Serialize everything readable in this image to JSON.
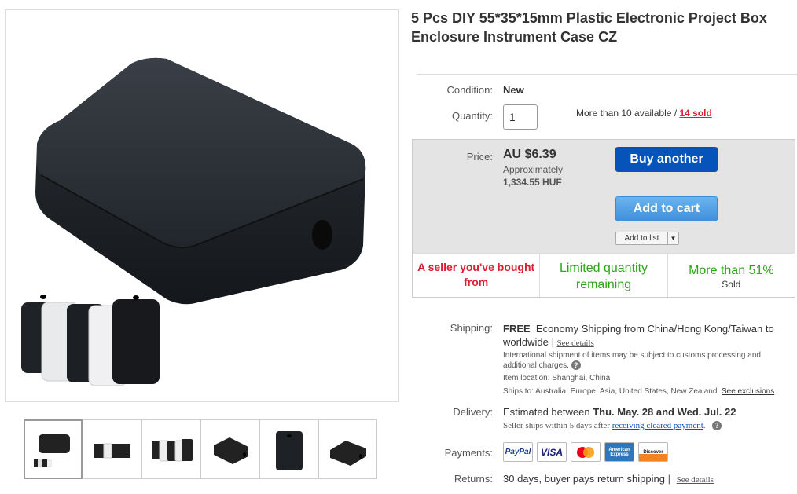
{
  "product": {
    "title": "5 Pcs DIY 55*35*15mm Plastic Electronic Project Box Enclosure Instrument Case CZ"
  },
  "thumbnails": [
    {
      "name": "thumb-1"
    },
    {
      "name": "thumb-2"
    },
    {
      "name": "thumb-3"
    },
    {
      "name": "thumb-4"
    },
    {
      "name": "thumb-5"
    },
    {
      "name": "thumb-6"
    }
  ],
  "condition": {
    "label": "Condition:",
    "value": "New"
  },
  "quantity": {
    "label": "Quantity:",
    "value": "1",
    "availability": "More than 10 available",
    "sep": "/",
    "sold": "14 sold"
  },
  "price": {
    "label": "Price:",
    "value": "AU $6.39",
    "approx_label": "Approximately",
    "approx_value": "1,334.55 HUF"
  },
  "buttons": {
    "buy": "Buy another",
    "cart": "Add to cart",
    "list": "Add to list"
  },
  "signals": {
    "seller": "A seller you've bought from",
    "limited": "Limited quantity remaining",
    "sold_pct": "More than 51%",
    "sold_word": "Sold"
  },
  "shipping": {
    "label": "Shipping:",
    "free": "FREE",
    "method": "Economy Shipping from China/Hong Kong/Taiwan to worldwide",
    "pipe": "|",
    "details_link": "See details",
    "intl_note": "International shipment of items may be subject to customs processing and additional charges.",
    "location_label": "Item location:",
    "location": "Shanghai, China",
    "ships_to_label": "Ships to:",
    "ships_to": "Australia, Europe, Asia, United States, New Zealand",
    "exclusions_link": "See exclusions"
  },
  "delivery": {
    "label": "Delivery:",
    "prefix": "Estimated between",
    "dates": "Thu. May. 28 and Wed. Jul. 22",
    "note_prefix": "Seller ships within 5 days after",
    "note_link": "receiving cleared payment",
    "note_suffix": "."
  },
  "payments": {
    "label": "Payments:",
    "methods": [
      "PayPal",
      "VISA",
      "MasterCard",
      "American Express",
      "Discover"
    ]
  },
  "returns": {
    "label": "Returns:",
    "value": "30 days, buyer pays return shipping",
    "pipe": "|",
    "link": "See details"
  },
  "colors": {
    "accent_blue": "#0654ba",
    "sold_red": "#dd1e31",
    "signal_green": "#2ba617"
  }
}
